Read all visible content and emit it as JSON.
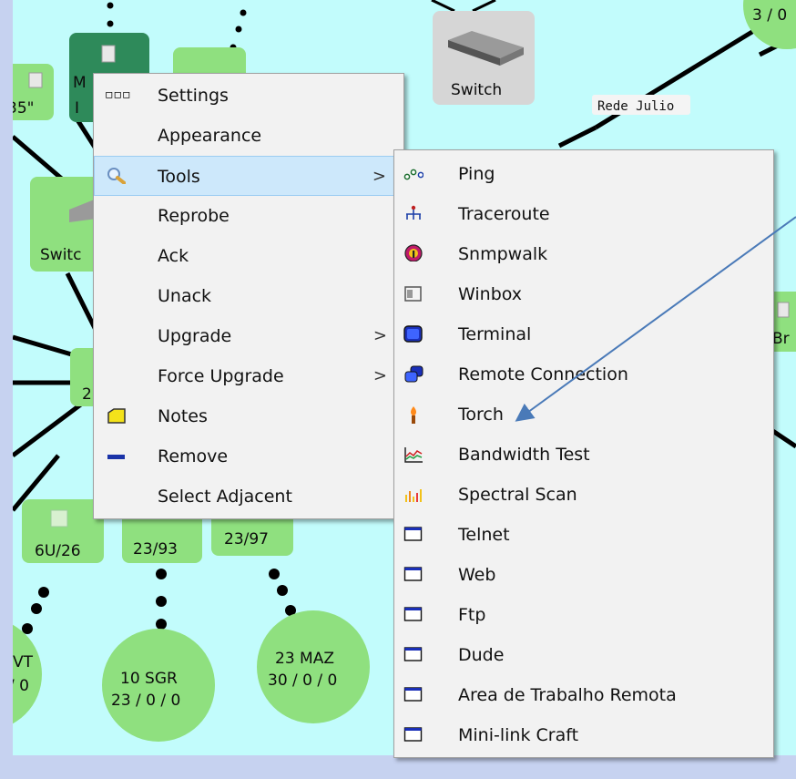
{
  "map": {
    "device_nodes": [
      {
        "label": "35\""
      },
      {
        "label": "M"
      },
      {
        "label": "I"
      },
      {
        "label": "Switch"
      },
      {
        "label": "Switc"
      },
      {
        "label": "2"
      },
      {
        "label": "6U/26"
      },
      {
        "label": "23/93"
      },
      {
        "label": "23/97"
      },
      {
        "label": "Br"
      }
    ],
    "rede_label": "Rede Julio",
    "circles": [
      {
        "line1": "3 / 0",
        "line2": ""
      },
      {
        "line1": "VT",
        "line2": "/ 0"
      },
      {
        "line1": "10 SGR",
        "line2": "23 / 0 / 0"
      },
      {
        "line1": "23 MAZ",
        "line2": "30 / 0 / 0"
      }
    ]
  },
  "context_menu": {
    "items": [
      {
        "label": "Settings",
        "icon": "dots-icon"
      },
      {
        "label": "Appearance",
        "icon": ""
      },
      {
        "label": "Tools",
        "icon": "wrench-magnifier-icon",
        "submenu": true
      },
      {
        "label": "Reprobe",
        "icon": ""
      },
      {
        "label": "Ack",
        "icon": ""
      },
      {
        "label": "Unack",
        "icon": ""
      },
      {
        "label": "Upgrade",
        "icon": "",
        "submenu": true
      },
      {
        "label": "Force Upgrade",
        "icon": "",
        "submenu": true
      },
      {
        "label": "Notes",
        "icon": "note-icon"
      },
      {
        "label": "Remove",
        "icon": "remove-icon"
      },
      {
        "label": "Select Adjacent",
        "icon": ""
      }
    ],
    "submenu_arrow": ">"
  },
  "tools_submenu": {
    "items": [
      {
        "label": "Ping",
        "icon": "ping-icon"
      },
      {
        "label": "Traceroute",
        "icon": "traceroute-icon"
      },
      {
        "label": "Snmpwalk",
        "icon": "snmpwalk-icon"
      },
      {
        "label": "Winbox",
        "icon": "winbox-icon"
      },
      {
        "label": "Terminal",
        "icon": "terminal-icon"
      },
      {
        "label": "Remote Connection",
        "icon": "remote-connection-icon"
      },
      {
        "label": "Torch",
        "icon": "torch-icon"
      },
      {
        "label": "Bandwidth Test",
        "icon": "bandwidth-test-icon"
      },
      {
        "label": "Spectral Scan",
        "icon": "spectral-scan-icon"
      },
      {
        "label": "Telnet",
        "icon": "window-icon"
      },
      {
        "label": "Web",
        "icon": "window-icon"
      },
      {
        "label": "Ftp",
        "icon": "window-icon"
      },
      {
        "label": "Dude",
        "icon": "window-icon"
      },
      {
        "label": "Area de Trabalho Remota",
        "icon": "window-icon"
      },
      {
        "label": "Mini-link Craft",
        "icon": "window-icon"
      }
    ]
  },
  "colors": {
    "canvas_bg": "#c2fcfc",
    "node_green": "#8fe07f",
    "node_dark_green": "#2e8a5a",
    "menu_bg": "#f2f2f2",
    "highlight_bg": "#cde8fb",
    "annotation_arrow": "#4a7ab8"
  }
}
